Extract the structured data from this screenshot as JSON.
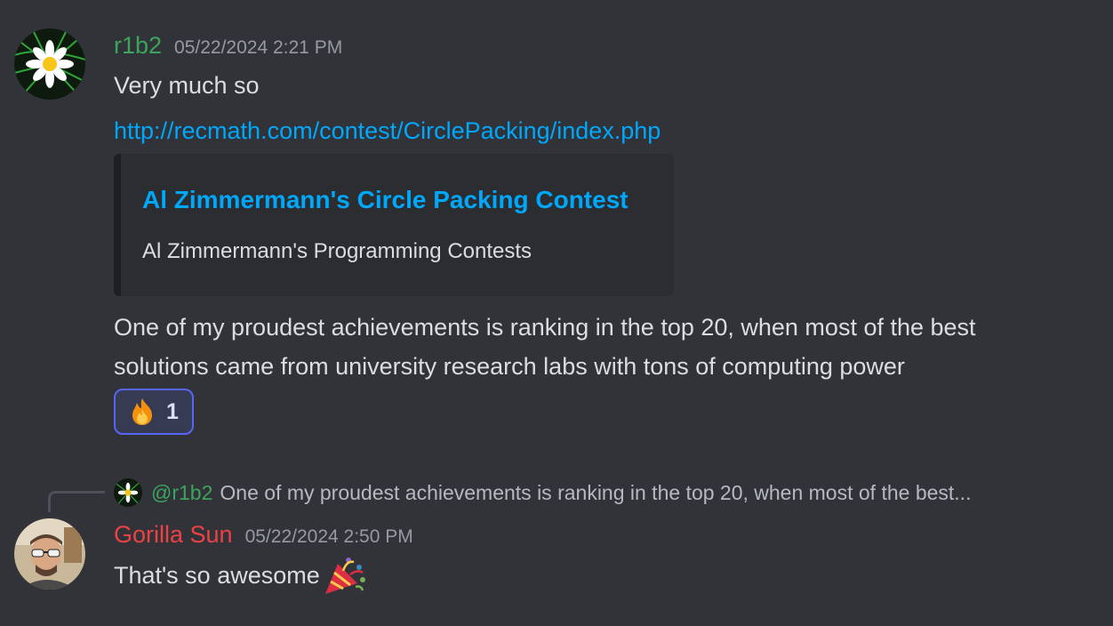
{
  "messages": [
    {
      "author": "r1b2",
      "author_color": "#3ba55d",
      "timestamp": "05/22/2024 2:21 PM",
      "text_1": "Very much so",
      "link": "http://recmath.com/contest/CirclePacking/index.php",
      "embed": {
        "title": "Al Zimmermann's Circle Packing Contest",
        "provider": "Al Zimmermann's Programming Contests"
      },
      "text_2_line_1": "One of my proudest achievements is ranking in the top 20, when most of the best",
      "text_2_line_2": "solutions came from university research labs with tons of computing power",
      "reaction": {
        "emoji": "fire-emoji",
        "count": "1"
      }
    },
    {
      "reply": {
        "mention": "@r1b2",
        "preview": "One of my proudest achievements is ranking in the top 20, when most of the best..."
      },
      "author": "Gorilla Sun",
      "author_color": "#ed4245",
      "timestamp": "05/22/2024 2:50 PM",
      "text": "That's so awesome",
      "emoji": "party-popper-emoji"
    }
  ],
  "icons": {
    "avatar_r1b2": "daisy-flower-avatar",
    "avatar_gorilla": "person-with-sunglasses-avatar"
  }
}
